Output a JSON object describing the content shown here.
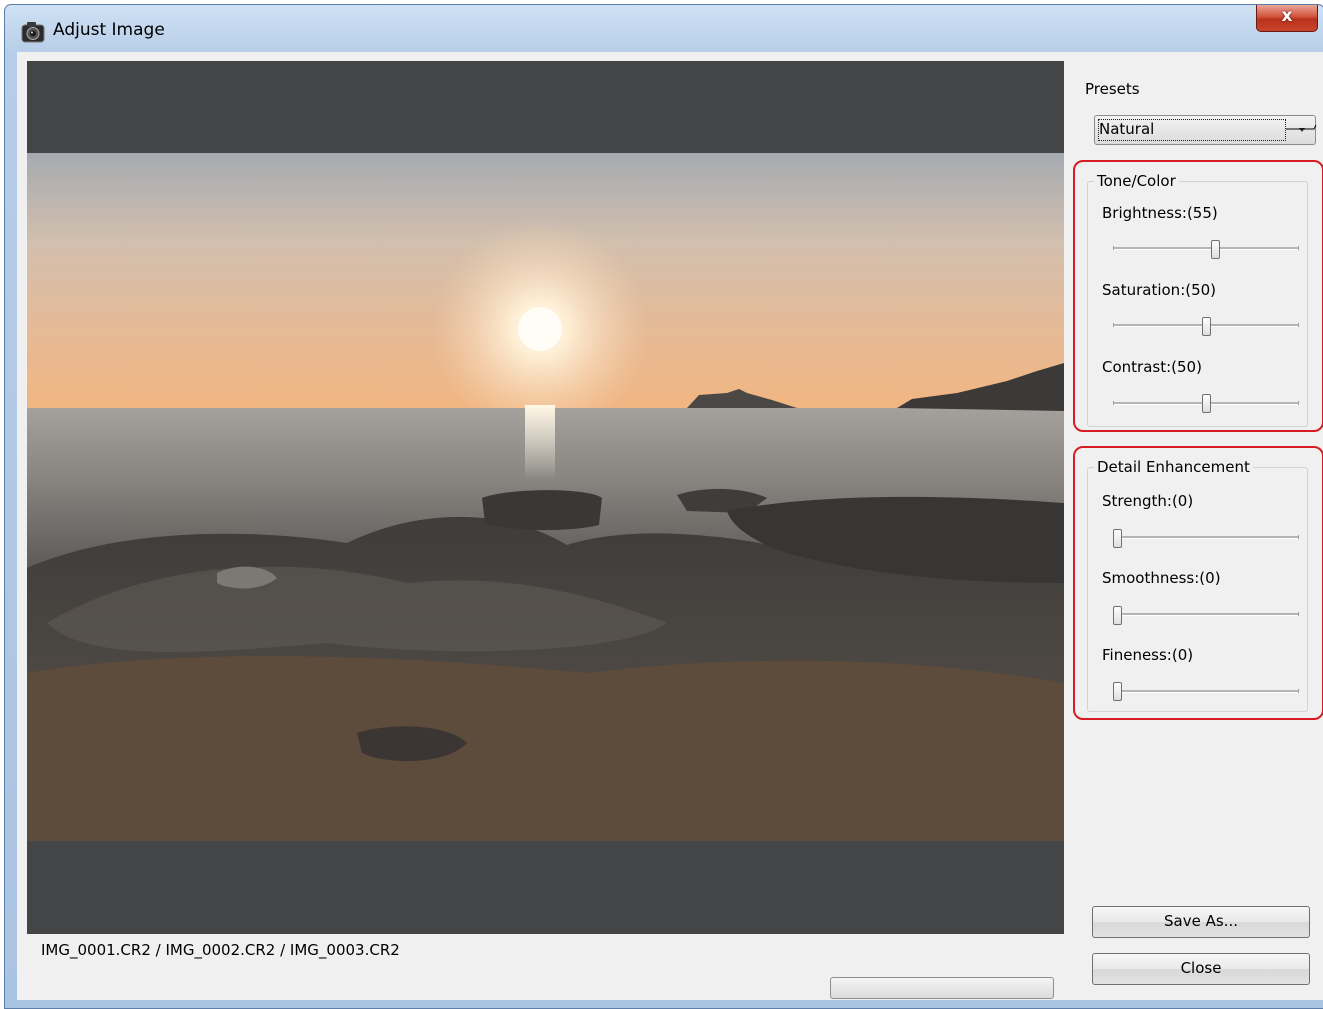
{
  "window": {
    "title": "Adjust Image",
    "close_label": "x"
  },
  "preview": {
    "file_list": "IMG_0001.CR2 / IMG_0002.CR2 / IMG_0003.CR2",
    "progress": 0
  },
  "presets": {
    "label": "Presets",
    "selected": "Natural"
  },
  "tone_color": {
    "title": "Tone/Color",
    "brightness": {
      "label": "Brightness:(55)",
      "value": 55
    },
    "saturation": {
      "label": "Saturation:(50)",
      "value": 50
    },
    "contrast": {
      "label": "Contrast:(50)",
      "value": 50
    }
  },
  "detail": {
    "title": "Detail Enhancement",
    "strength": {
      "label": "Strength:(0)",
      "value": 0
    },
    "smoothness": {
      "label": "Smoothness:(0)",
      "value": 0
    },
    "fineness": {
      "label": "Fineness:(0)",
      "value": 0
    }
  },
  "buttons": {
    "save_as": "Save As...",
    "close": "Close"
  },
  "colors": {
    "highlight": "#d81c24",
    "preview_bg": "#444546"
  },
  "icons": {
    "window_icon": "camera-icon",
    "close": "close-icon"
  }
}
